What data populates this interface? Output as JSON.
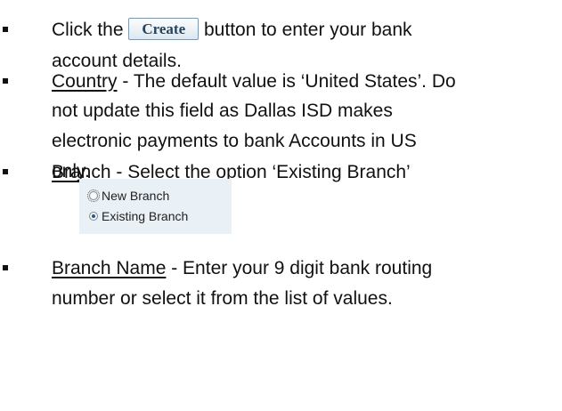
{
  "instructions": {
    "item1": {
      "prefix": "Click the",
      "button": "Create",
      "suffix_line1": "button to enter your bank",
      "line2": "account details."
    },
    "item2": {
      "field": "Country",
      "line1_rest": " - The default value is ‘United States’. Do",
      "line2": "not update this field as Dallas ISD makes",
      "line3": "electronic payments to bank Accounts in US",
      "line4": "only."
    },
    "item3": {
      "field": "Branch",
      "line1_rest": " - Select the option ‘Existing Branch’",
      "options": [
        {
          "label": "New Branch",
          "checked": false
        },
        {
          "label": "Existing Branch",
          "checked": true
        }
      ]
    },
    "item4": {
      "field": "Branch Name",
      "line1_rest": " - Enter your 9 digit bank routing",
      "line2": "number or select it from the list of values."
    }
  }
}
